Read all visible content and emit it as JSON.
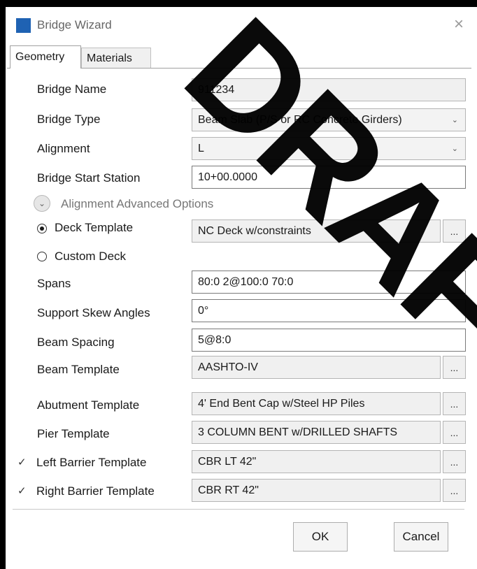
{
  "window": {
    "title": "Bridge Wizard",
    "close_glyph": "×",
    "watermark": "DRAFT"
  },
  "tabs": [
    {
      "label": "Geometry",
      "active": true
    },
    {
      "label": "Materials",
      "active": false
    }
  ],
  "fields": {
    "bridge_name": {
      "label": "Bridge Name",
      "value": "911234"
    },
    "bridge_type": {
      "label": "Bridge Type",
      "value": "Beam Slab (P/S or RC Concrete Girders)"
    },
    "alignment": {
      "label": "Alignment",
      "value": "L"
    },
    "start_station": {
      "label": "Bridge Start Station",
      "value": "10+00.0000"
    },
    "advanced": {
      "label": "Alignment Advanced Options"
    },
    "deck_template": {
      "label": "Deck Template",
      "value": "NC Deck w/constraints",
      "selected": true
    },
    "custom_deck": {
      "label": "Custom Deck",
      "selected": false
    },
    "spans": {
      "label": "Spans",
      "value": "80:0 2@100:0 70:0"
    },
    "skew": {
      "label": "Support Skew Angles",
      "value": "0°"
    },
    "beam_spacing": {
      "label": "Beam Spacing",
      "value": "5@8:0"
    },
    "beam_template": {
      "label": "Beam Template",
      "value": "AASHTO-IV"
    },
    "abutment_template": {
      "label": "Abutment Template",
      "value": "4' End Bent Cap w/Steel HP Piles"
    },
    "pier_template": {
      "label": "Pier Template",
      "value": "3 COLUMN BENT w/DRILLED SHAFTS"
    },
    "left_barrier": {
      "label": "Left Barrier Template",
      "value": "CBR LT 42\"",
      "checked": true
    },
    "right_barrier": {
      "label": "Right Barrier Template",
      "value": "CBR RT 42\"",
      "checked": true
    }
  },
  "browse_label": "...",
  "buttons": {
    "ok": "OK",
    "cancel": "Cancel"
  },
  "colors": {
    "accent_icon": "#1f62b3"
  }
}
